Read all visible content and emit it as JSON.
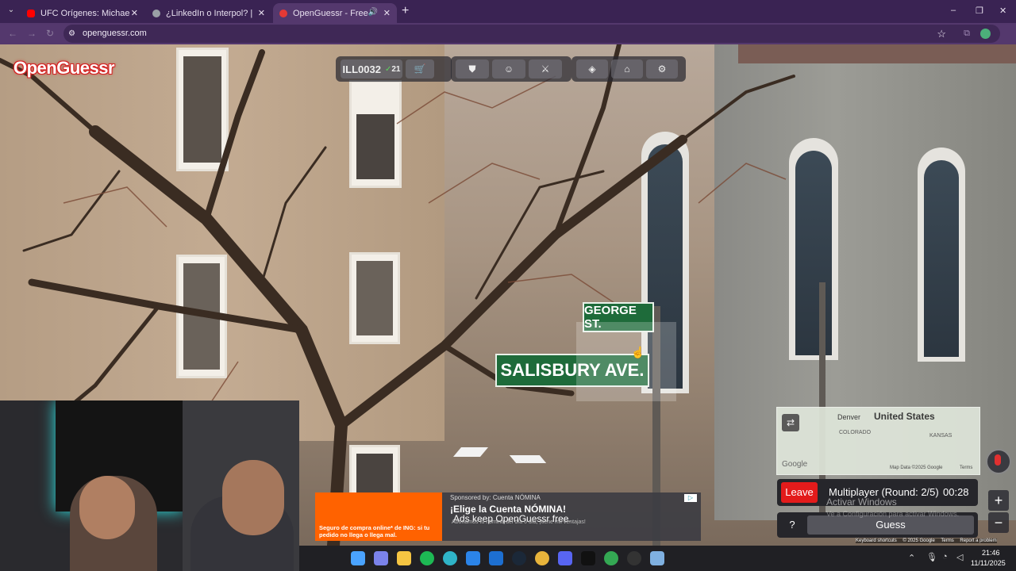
{
  "browser": {
    "tabs": [
      {
        "title": "UFC Orígenes: Michael Morales",
        "favicon_color": "#ff0000"
      },
      {
        "title": "¿LinkedIn o Interpol? | El test m",
        "favicon_color": "#9aa0a6"
      },
      {
        "title": "OpenGuessr - Free GeoGue",
        "favicon_color": "#e53935"
      }
    ],
    "new_tab": "+",
    "url": "openguessr.com",
    "window_controls": {
      "minimize": "–",
      "restore": "❐",
      "close": "✕"
    }
  },
  "game": {
    "logo": "OpenGuessr",
    "player_name": "ILL0032",
    "streak": "21",
    "toolbar_icons": [
      "cart-icon",
      "trophy-icon",
      "people-icon",
      "swords-icon",
      "layers-icon",
      "graduation-cap-icon",
      "gear-icon"
    ],
    "street_signs": {
      "top": "GEORGE ST.",
      "bottom": "SALISBURY AVE."
    },
    "minimap": {
      "country": "United States",
      "labels": [
        "Denver",
        "COLORADO",
        "KANSAS"
      ],
      "attribution": "Map Data ©2025 Google",
      "terms": "Terms",
      "google": "Google"
    },
    "leave_label": "Leave",
    "mode_label": "Multiplayer (Round: 2/5)",
    "timer": "00:28",
    "help_label": "?",
    "guess_label": "Guess",
    "zoom_in": "+",
    "zoom_out": "−",
    "footer_links": [
      "Keyboard shortcuts",
      "© 2025 Google",
      "Terms",
      "Report a problem"
    ]
  },
  "windows_activation": {
    "title": "Activar Windows",
    "subtitle": "Ve a Configuración para activar Windows."
  },
  "ad": {
    "sponsor": "Sponsored by: Cuenta NÓMINA",
    "headline": "¡Elige la Cuenta NÓMINA!",
    "overlay": "Ads keep OpenGuessr free.",
    "sub": "Abonamos tu nómina del día 6 día, ¡tiene mil ventajas!",
    "left_text": "Seguro de compra online* de ING: si tu pedido no llega o llega mal."
  },
  "taskbar": {
    "time": "21:46",
    "date": "11/11/2025"
  }
}
